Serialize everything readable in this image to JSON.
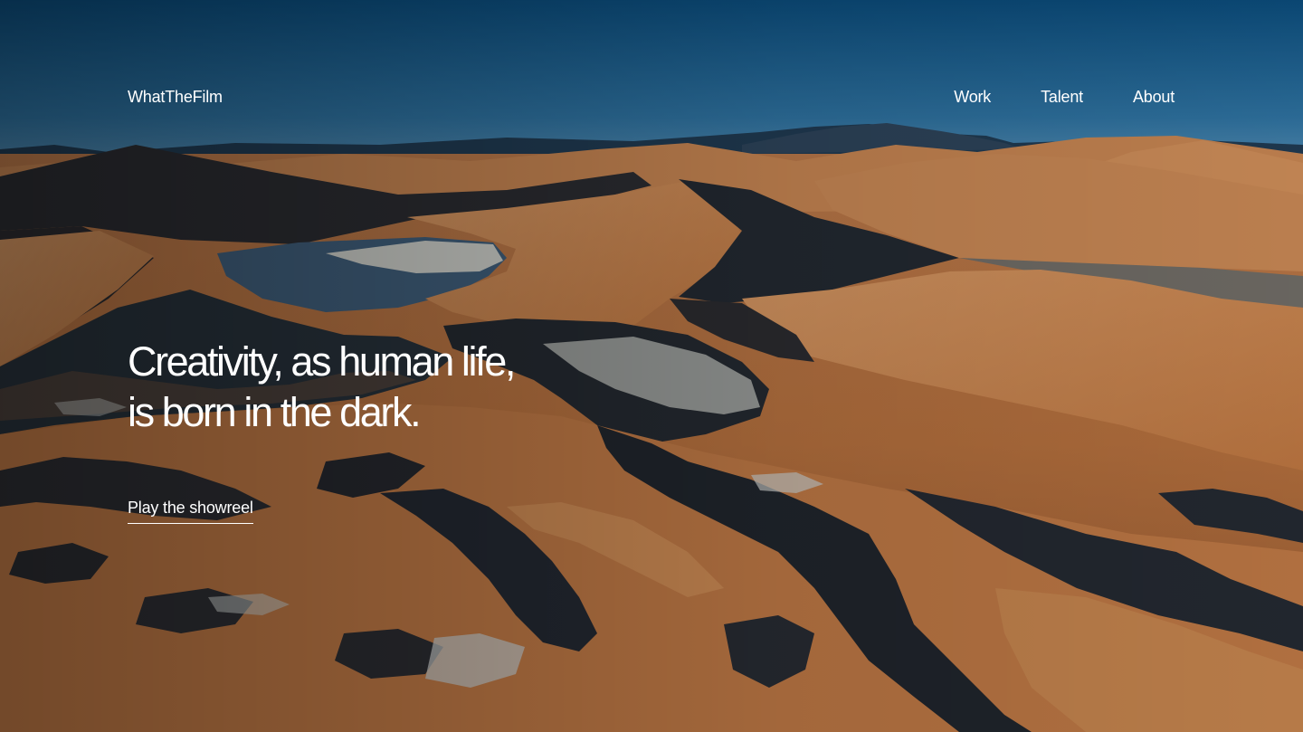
{
  "header": {
    "logo_text": "WhatTheFilm",
    "nav": [
      {
        "label": "Work"
      },
      {
        "label": "Talent"
      },
      {
        "label": "About"
      }
    ]
  },
  "hero": {
    "headline_lines": [
      "Creativity, as human life,",
      "is born in the dark."
    ],
    "cta_label": "Play the showreel",
    "background_image": "aerial-desert-dunes"
  },
  "colors": {
    "text": "#ffffff",
    "sky_top": "#0d4a7a",
    "sky_horizon": "#3f7aa6",
    "sand": "#c07a40",
    "shadow": "#1a2530"
  }
}
